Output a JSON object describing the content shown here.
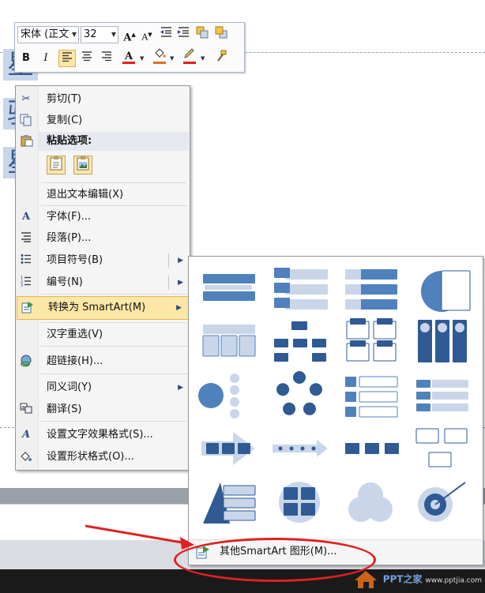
{
  "background": {
    "slide_text": [
      "星",
      "驴",
      "星"
    ],
    "watermark_brand": "PPT之家",
    "watermark_url": "www.pptjia.com"
  },
  "mini_toolbar": {
    "font_name": "宋体 (正文",
    "font_size": "32",
    "buttons": [
      "grow-font",
      "shrink-font",
      "decrease-indent",
      "increase-indent",
      "bring-forward",
      "send-backward"
    ],
    "bold": "B",
    "italic": "I",
    "font_color_glyph": "A",
    "font_color": "#e02020",
    "fill_color": "#e0701c",
    "line_color": "#e02020"
  },
  "context_menu": {
    "items": [
      {
        "label": "剪切(T)",
        "icon": "scissors-icon"
      },
      {
        "label": "复制(C)",
        "icon": "copy-icon"
      },
      {
        "label": "粘贴选项:",
        "icon": "paste-icon"
      },
      {
        "label": "退出文本编辑(X)",
        "icon": ""
      },
      {
        "label": "字体(F)...",
        "icon": "font-icon"
      },
      {
        "label": "段落(P)...",
        "icon": "paragraph-icon"
      },
      {
        "label": "项目符号(B)",
        "icon": "bullets-icon",
        "submenu": true
      },
      {
        "label": "编号(N)",
        "icon": "numbering-icon",
        "submenu": true
      },
      {
        "label": "转换为 SmartArt(M)",
        "icon": "smartart-icon",
        "submenu": true,
        "highlighted": true
      },
      {
        "label": "汉字重选(V)",
        "icon": ""
      },
      {
        "label": "超链接(H)...",
        "icon": "hyperlink-icon"
      },
      {
        "label": "同义词(Y)",
        "icon": "",
        "submenu": true
      },
      {
        "label": "翻译(S)",
        "icon": "translate-icon"
      },
      {
        "label": "设置文字效果格式(S)...",
        "icon": "text-effects-icon"
      },
      {
        "label": "设置形状格式(O)...",
        "icon": "shape-format-icon"
      }
    ]
  },
  "smartart_gallery": {
    "layouts": [
      "vertical-bullet-list",
      "vertical-box-list",
      "vertical-chevron-list",
      "trapezoid-list",
      "table-list",
      "hierarchy",
      "hierarchy-list",
      "vertical-picture-list",
      "radial-cluster",
      "basic-cycle",
      "vertical-chevron-process",
      "horizontal-chevron",
      "arrow-process",
      "timeline",
      "basic-process",
      "picture-org",
      "pyramid-list",
      "matrix",
      "venn",
      "target"
    ],
    "more_label": "其他SmartArt 图形(M)..."
  },
  "colors": {
    "menu_highlight": "#fde7a6",
    "accent_blue": "#4f81bd",
    "annotation_red": "#e02020"
  }
}
